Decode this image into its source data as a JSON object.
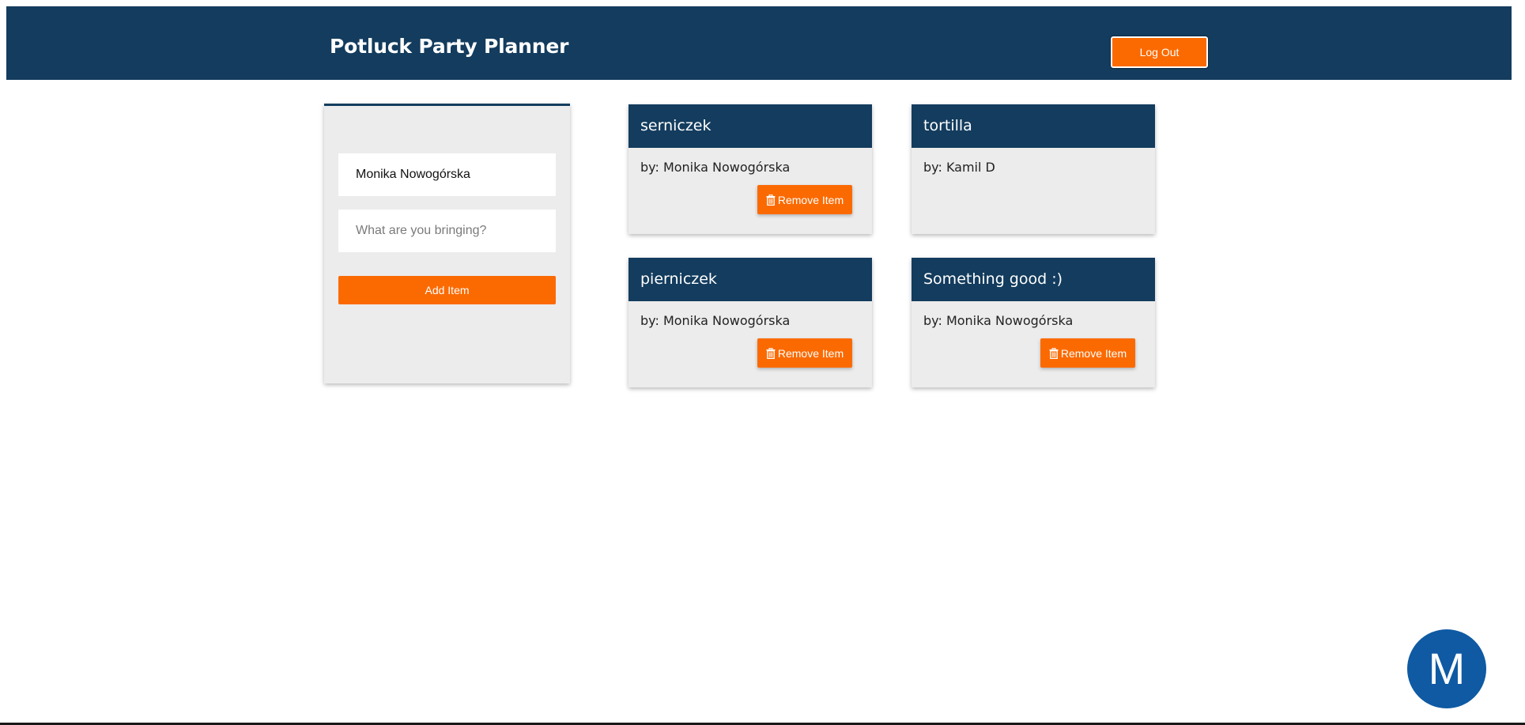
{
  "header": {
    "title": "Potluck Party Planner",
    "logout_label": "Log Out"
  },
  "form": {
    "name_value": "Monika Nowogórska",
    "item_placeholder": "What are you bringing?",
    "add_label": "Add Item"
  },
  "items": [
    {
      "title": "serniczek",
      "by": "by: Monika Nowogórska",
      "remove_label": "Remove Item",
      "removable": true
    },
    {
      "title": "tortilla",
      "by": "by: Kamil D",
      "removable": false
    },
    {
      "title": "pierniczek",
      "by": "by: Monika Nowogórska",
      "remove_label": "Remove Item",
      "removable": true
    },
    {
      "title": "Something good :)",
      "by": "by: Monika Nowogórska",
      "remove_label": "Remove Item",
      "removable": true
    }
  ],
  "avatar": {
    "initial": "M",
    "color": "#0f5aa3"
  },
  "colors": {
    "primary": "#133c5e",
    "accent": "#fb6a01",
    "card_bg": "#ececec"
  },
  "icons": {
    "remove": "trash-icon"
  }
}
